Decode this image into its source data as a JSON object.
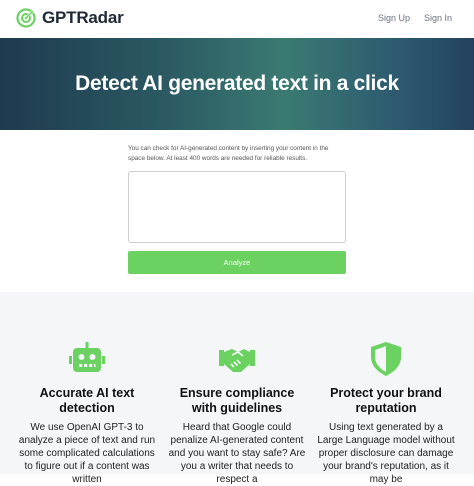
{
  "brand": {
    "name": "GPTRadar",
    "accent": "#6bd160"
  },
  "nav": {
    "sign_up": "Sign Up",
    "sign_in": "Sign In"
  },
  "hero": {
    "title": "Detect AI generated text in a click"
  },
  "form": {
    "hint": "You can check for AI-generated content by inserting your content in the space below. At least 400 words are needed for reliable results.",
    "textarea_value": "",
    "analyze_label": "Analyze"
  },
  "features": [
    {
      "icon": "robot-icon",
      "title": "Accurate AI text detection",
      "body": "We use OpenAI GPT-3 to analyze a piece of text and run some complicated calculations to figure out if a content was written"
    },
    {
      "icon": "handshake-icon",
      "title": "Ensure compliance with guidelines",
      "body": "Heard that Google could penalize AI-generated content and you want to stay safe? Are you a writer that needs to respect a"
    },
    {
      "icon": "shield-icon",
      "title": "Protect your brand reputation",
      "body": "Using text generated by a Large Language model without proper disclosure can damage your brand's reputation, as it may be"
    }
  ]
}
